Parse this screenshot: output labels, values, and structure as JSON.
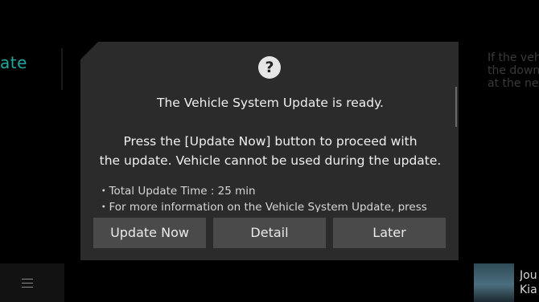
{
  "background": {
    "left_text": "ate",
    "right_text": "If the vehi\nthe down\nat the ne",
    "media_title": "Jou\nKia"
  },
  "dialog": {
    "icon": "question-icon",
    "icon_glyph": "?",
    "title": "The Vehicle System Update is ready.",
    "message_line1": "Press the [Update Now] button to proceed with",
    "message_line2": "the update. Vehicle cannot be used during the update.",
    "bullets": [
      "・Total Update Time : 25 min",
      "・For more information on the Vehicle System Update, press"
    ],
    "buttons": {
      "update_now": "Update Now",
      "detail": "Detail",
      "later": "Later"
    }
  },
  "colors": {
    "dialog_bg": "#2b2b2b",
    "button_bg": "#4a4a4a",
    "accent_teal": "#1fa8a0"
  }
}
